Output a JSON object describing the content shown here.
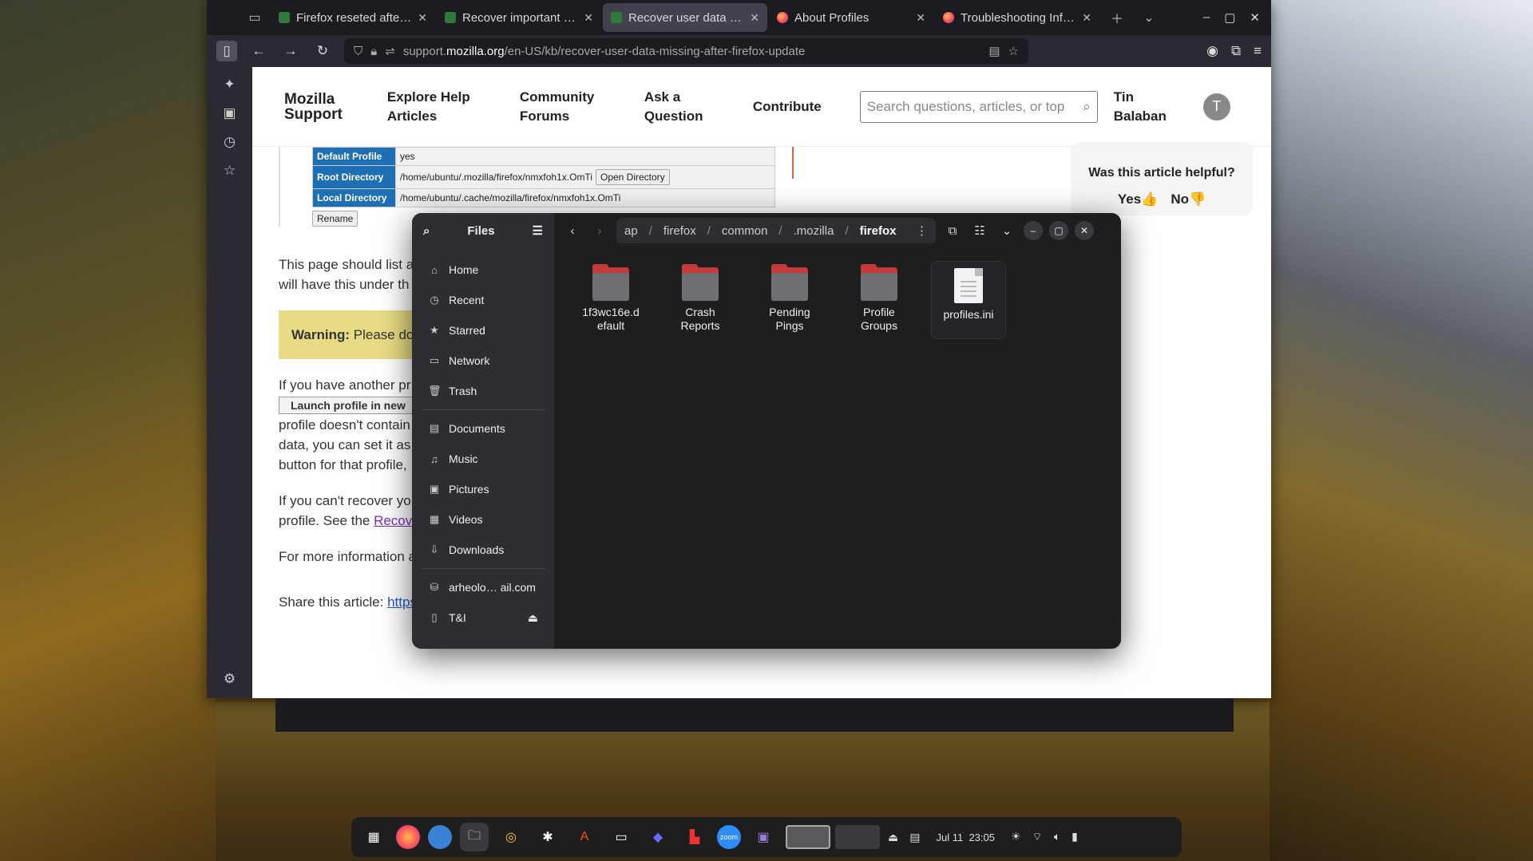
{
  "browser": {
    "tabs": [
      {
        "title": "Firefox reseted after re",
        "active": false
      },
      {
        "title": "Recover important dat",
        "active": false
      },
      {
        "title": "Recover user data miss",
        "active": true
      },
      {
        "title": "About Profiles",
        "active": false
      },
      {
        "title": "Troubleshooting Inform",
        "active": false
      }
    ],
    "url_prefix": "support.",
    "url_domain": "mozilla.org",
    "url_path": "/en-US/kb/recover-user-data-missing-after-firefox-update"
  },
  "site": {
    "logo_line1": "Mozilla",
    "logo_line2": "Support",
    "nav": [
      "Explore Help Articles",
      "Community Forums",
      "Ask a Question",
      "Contribute"
    ],
    "search_placeholder": "Search questions, articles, or top",
    "user_name": "Tin Balaban",
    "avatar_letter": "T"
  },
  "profile_table": {
    "default_label": "Default Profile",
    "default_value": "yes",
    "root_label": "Root Directory",
    "root_value": "/home/ubuntu/.mozilla/firefox/nmxfoh1x.OmTi",
    "local_label": "Local Directory",
    "local_value": "/home/ubuntu/.cache/mozilla/firefox/nmxfoh1x.OmTi",
    "open_dir": "Open Directory",
    "rename": "Rename"
  },
  "article": {
    "p1a": "This page should list a",
    "p1b": "will have this under th",
    "warning_bold": "Warning:",
    "warning_text": " Please do",
    "p2a": "If you have another pr",
    "launch_btn": "Launch profile in new",
    "p2b": "profile doesn't contain",
    "p2c": "data, you can set it as",
    "p2d": "button for that profile,",
    "p3a": "If you can't recover yo",
    "p3b": "profile. See the ",
    "p3_link": "Recov",
    "p4": "For more information a",
    "share_label": "Share this article: ",
    "share_link": "https://mzl.la/3VorcpU"
  },
  "helpful": {
    "question": "Was this article helpful?",
    "yes": "Yes👍",
    "no": "No👎"
  },
  "files": {
    "title": "Files",
    "places": [
      "Home",
      "Recent",
      "Starred",
      "Network",
      "Trash"
    ],
    "folders": [
      "Documents",
      "Music",
      "Pictures",
      "Videos",
      "Downloads"
    ],
    "devices": [
      "arheolo… ail.com",
      "T&I"
    ],
    "path": [
      "ap",
      "firefox",
      "common",
      ".mozilla",
      "firefox"
    ],
    "items": [
      {
        "name": "1f3wc16e.d efault",
        "kind": "folder"
      },
      {
        "name": "Crash Reports",
        "kind": "folder"
      },
      {
        "name": "Pending Pings",
        "kind": "folder"
      },
      {
        "name": "Profile Groups",
        "kind": "folder"
      },
      {
        "name": "profiles.ini",
        "kind": "file"
      }
    ]
  },
  "taskbar": {
    "date": "Jul 11",
    "time": "23:05"
  }
}
